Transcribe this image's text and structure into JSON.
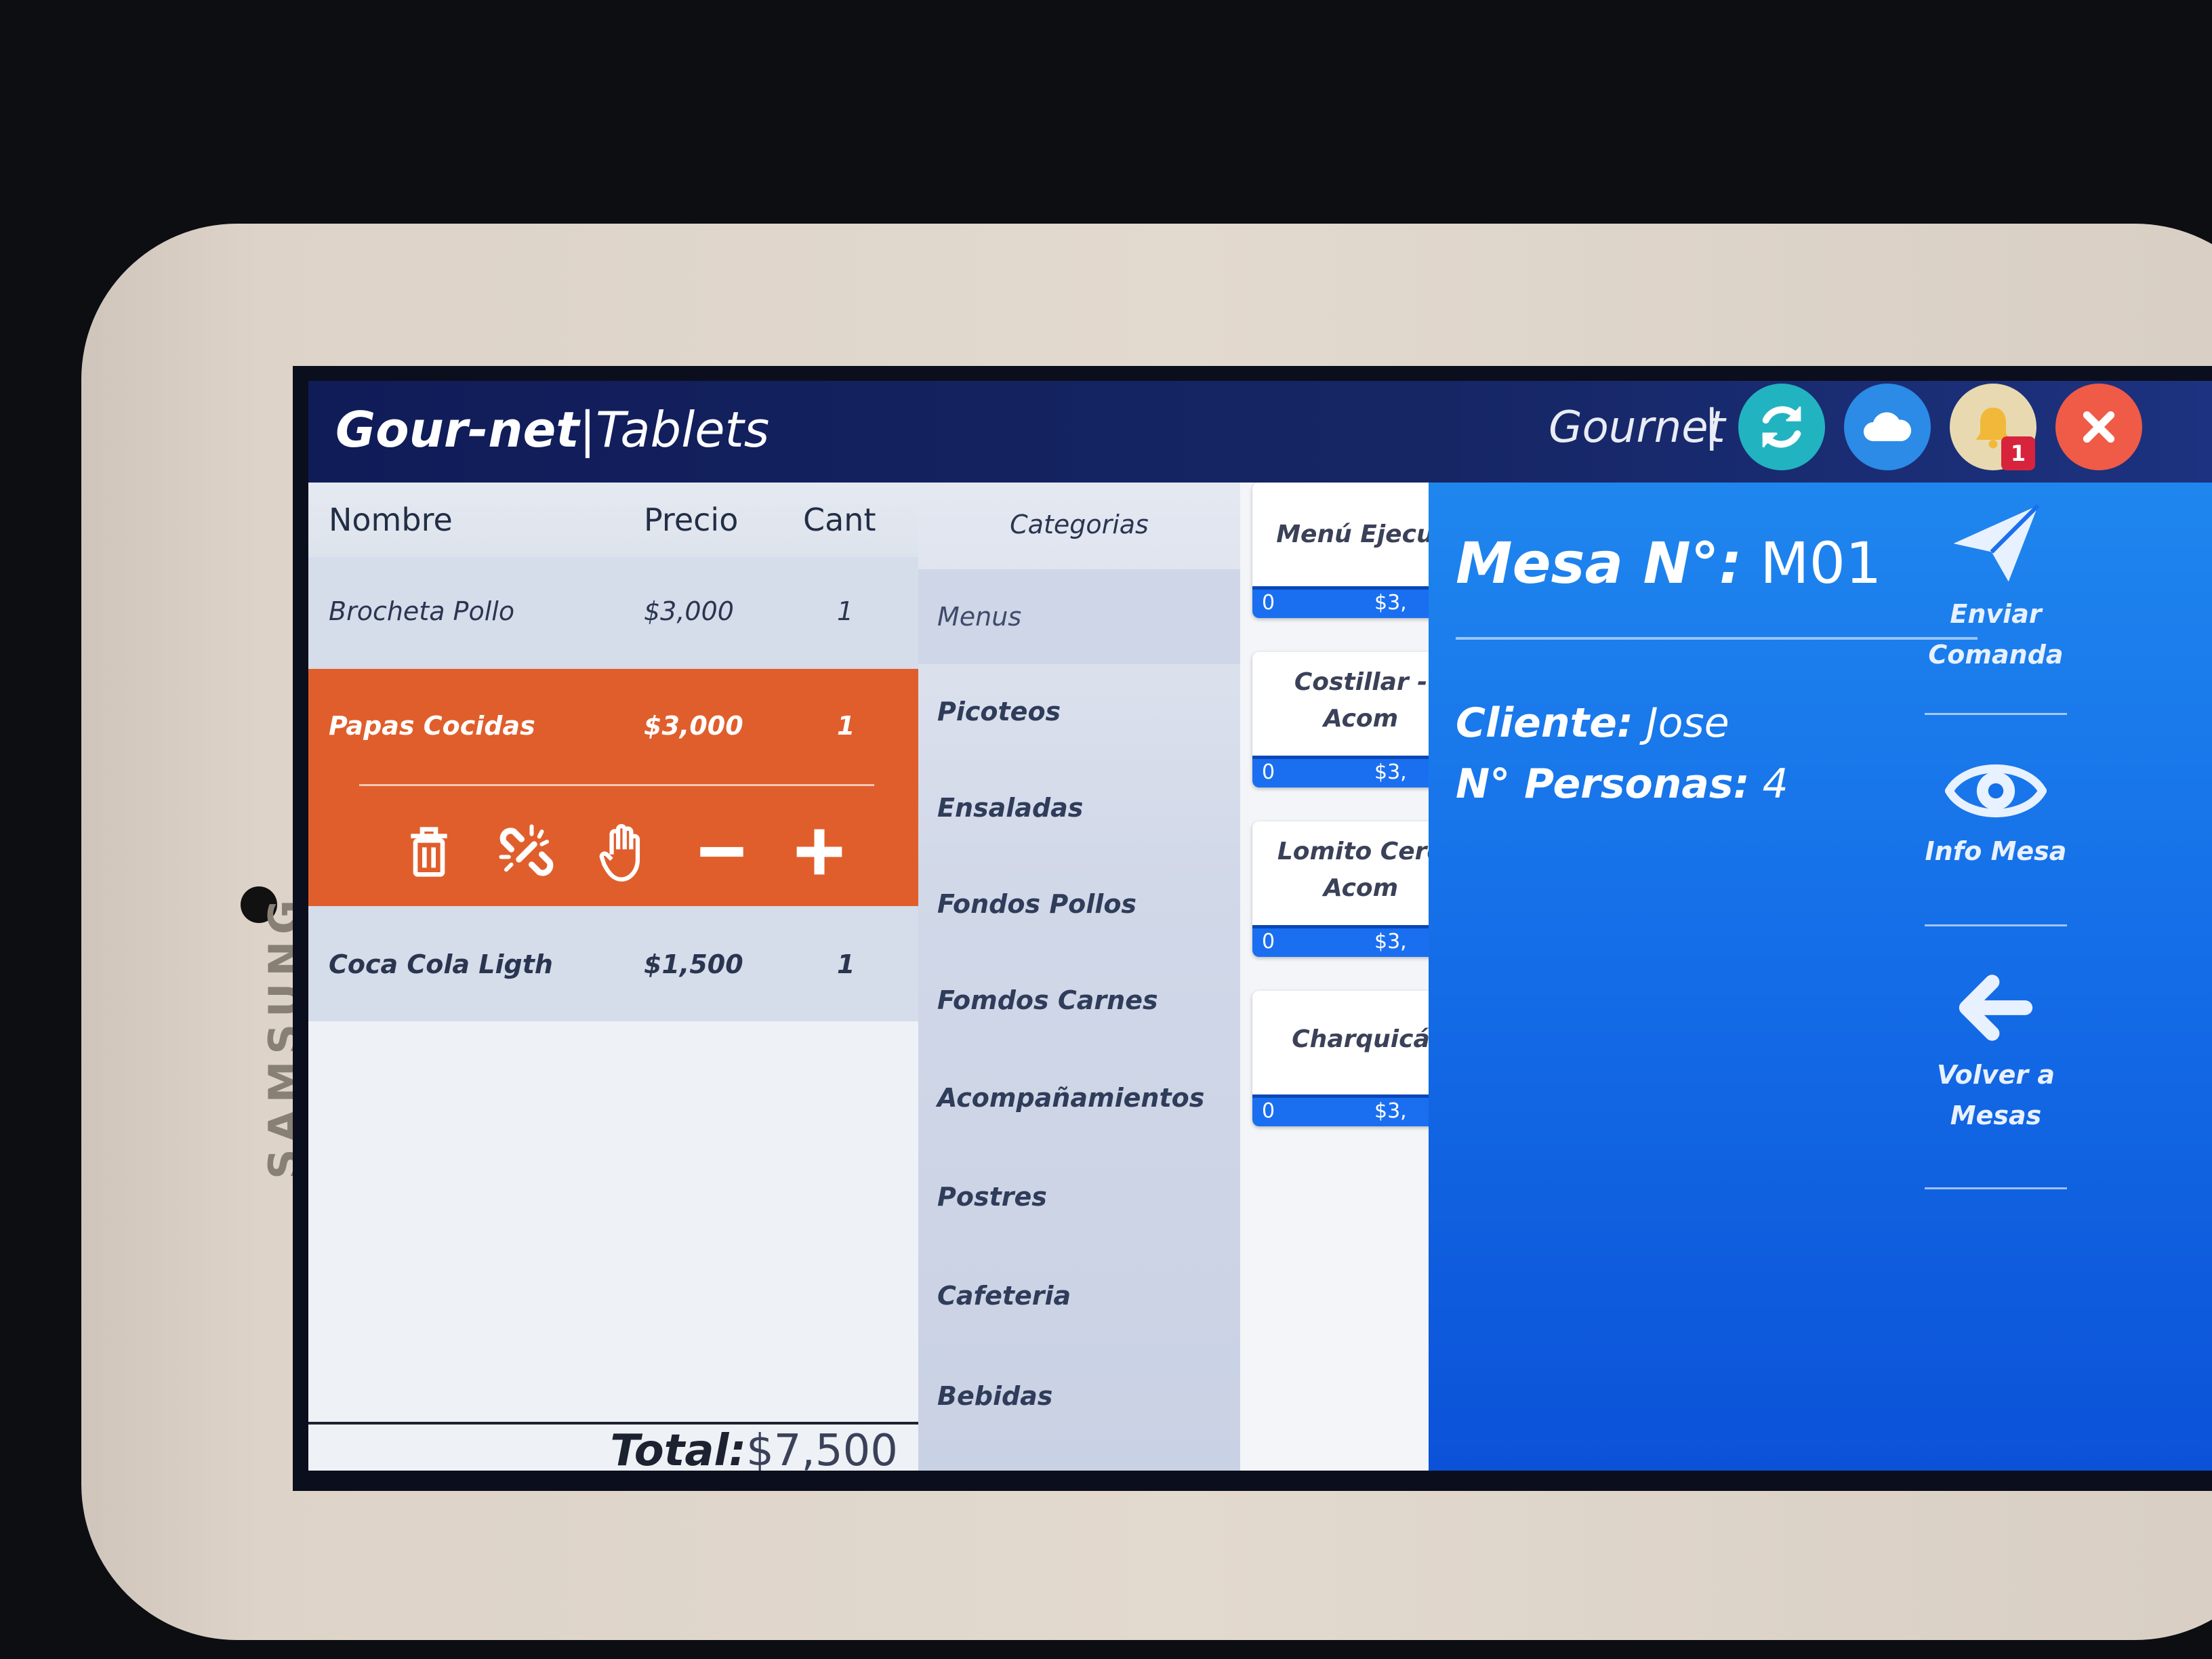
{
  "device": {
    "brand": "SAMSUNG"
  },
  "header": {
    "title_bold": "Gour-net",
    "title_sep": "|",
    "title_light": "Tablets",
    "user": "Gournet",
    "user_sep": "|",
    "notification_count": "1",
    "colors": {
      "refresh": "#22b3c1",
      "cloud": "#2b8be6",
      "bell": "#e8d9b0",
      "close": "#ef5b47"
    },
    "buttons": [
      {
        "icon": "refresh-icon"
      },
      {
        "icon": "cloud-icon"
      },
      {
        "icon": "bell-icon"
      },
      {
        "icon": "close-icon"
      }
    ]
  },
  "order": {
    "columns": {
      "name": "Nombre",
      "price": "Precio",
      "qty": "Cant"
    },
    "items": [
      {
        "name": "Brocheta Pollo",
        "price": "$3,000",
        "qty": "1"
      },
      {
        "name": "Papas Cocidas",
        "price": "$3,000",
        "qty": "1",
        "selected": true
      },
      {
        "name": "Coca Cola Ligth",
        "price": "$1,500",
        "qty": "1"
      }
    ],
    "actions": [
      "trash-icon",
      "unlink-icon",
      "hand-icon",
      "minus-icon",
      "plus-icon"
    ],
    "total_label": "Total:",
    "total_value": "$7,500",
    "selected_color": "#e05e2b"
  },
  "categories": {
    "title": "Categorias",
    "items": [
      "Menus",
      "Picoteos",
      "Ensaladas",
      "Fondos Pollos",
      "Fomdos Carnes",
      "Acompañamientos",
      "Postres",
      "Cafeteria",
      "Bebidas"
    ],
    "active": "Menus"
  },
  "products": [
    {
      "name": "Menú Ejecut",
      "qty": "0",
      "price": "$3,"
    },
    {
      "name": "Costillar -\nAcom",
      "qty": "0",
      "price": "$3,"
    },
    {
      "name": "Lomito Cerd\nAcom",
      "qty": "0",
      "price": "$3,"
    },
    {
      "name": "Charquicá",
      "qty": "0",
      "price": "$3,"
    }
  ],
  "mesa": {
    "label": "Mesa N°:",
    "value": "M01",
    "cliente_label": "Cliente:",
    "cliente_value": "Jose",
    "personas_label": "N° Personas:",
    "personas_value": "4",
    "panel_color": "#156fe8"
  },
  "side_actions": [
    {
      "label": "Enviar\nComanda",
      "icon": "send-icon"
    },
    {
      "label": "Info Mesa",
      "icon": "eye-icon"
    },
    {
      "label": "Volver a\nMesas",
      "icon": "arrow-left-icon"
    }
  ]
}
